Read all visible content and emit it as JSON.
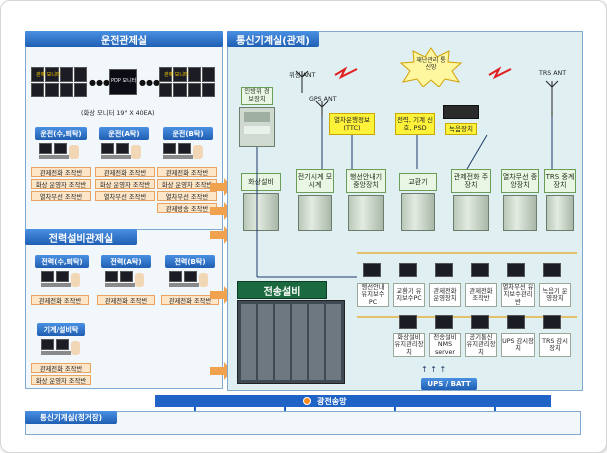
{
  "left_panel": {
    "title": "운전관제실",
    "monitors": [
      {
        "label": "관제 모니터"
      },
      {
        "label": "PDP 모니터"
      },
      {
        "label": "관제 모니터"
      }
    ],
    "monitor_caption": "(화상 모니터 19\" X 40EA)",
    "groups": [
      {
        "title": "운전(수,퇴탁)",
        "items": [
          "관제전화 조작반",
          "화상 운영자 조작반",
          "열차무선 조작반"
        ]
      },
      {
        "title": "운전(A탁)",
        "items": [
          "관제전화 조작반",
          "화상 운영자 조작반",
          "열차무선 조작반"
        ]
      },
      {
        "title": "운전(B탁)",
        "items": [
          "관제전화 조작반",
          "화상 운영자 조작반",
          "열차무선 조작반",
          "관제방송 조작반"
        ]
      }
    ]
  },
  "power_panel": {
    "title": "전력설비관제실",
    "groups": [
      {
        "title": "전력(수,퇴탁)",
        "items": [
          "관제전화 조작반"
        ]
      },
      {
        "title": "전력(A탁)",
        "items": [
          "관제전화 조작반"
        ]
      },
      {
        "title": "전력(B탁)",
        "items": [
          "관제전화 조작반"
        ]
      }
    ],
    "machine_group": {
      "title": "기계/설비탁",
      "items": [
        "관제전화 조작반",
        "화상 운영자 조작반"
      ]
    }
  },
  "right_panel": {
    "title": "통신기계실(관제)",
    "callout": "재난관리 통신망",
    "antennas": {
      "wireless": "위성 ANT",
      "gps": "GPS ANT",
      "trs": "TRS ANT"
    },
    "equipment": {
      "emergency": "인방위 경보장치",
      "gps_clock": "전기시계 모시계",
      "tracking_info": "열차운행정보 (TTC)",
      "power_ctrl": "전력, 기계 신호, PSD",
      "recorder": "녹음장치",
      "video": "화상설비",
      "clock_device": "전기시계 모시계",
      "train_info_device": "행선안내기 중앙장치",
      "exchange": "교환기",
      "control_phone": "관제전화 주장치",
      "radio": "열차무선 중앙장치",
      "trs": "TRS 중계장치"
    },
    "transmission": "전송설비",
    "terminals_row1": [
      "행선안내 유지보수PC",
      "교환기 유지보수PC",
      "관제전화 운영장치",
      "관제전화 조작반",
      "열차무선 유지보수관리반",
      "녹음기 운영장치"
    ],
    "terminals_row2": [
      "화상설비 유지관리장치",
      "전송설비 NMS server",
      "공기통신 유지관리장치",
      "UPS 감시장치",
      "TRS 감시장치"
    ],
    "ups": "UPS / BATT"
  },
  "bottom": {
    "network": "광전송망",
    "station_room": "통신기계실(정거장)"
  },
  "colors": {
    "accent_blue": "#1f5fb3",
    "panel_bg": "#dfeff2",
    "line_orange": "#f0a24e"
  }
}
